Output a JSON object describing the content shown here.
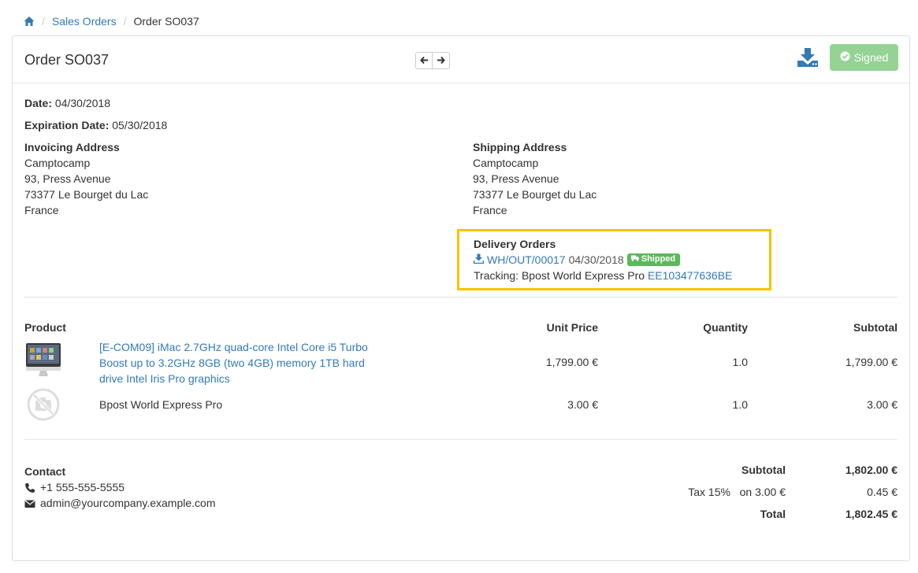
{
  "breadcrumb": {
    "home_icon": "home-icon",
    "sales_orders": "Sales Orders",
    "current": "Order SO037"
  },
  "header": {
    "title": "Order SO037",
    "prev_icon": "arrow-left-icon",
    "next_icon": "arrow-right-icon",
    "download_icon": "download-icon",
    "signed_label": "Signed",
    "signed_icon": "check-circle-icon"
  },
  "dates": {
    "date_label": "Date:",
    "date_value": "04/30/2018",
    "expiration_label": "Expiration Date:",
    "expiration_value": "05/30/2018"
  },
  "invoicing": {
    "title": "Invoicing Address",
    "lines": [
      "Camptocamp",
      "93, Press Avenue",
      "73377 Le Bourget du Lac",
      "France"
    ]
  },
  "shipping": {
    "title": "Shipping Address",
    "lines": [
      "Camptocamp",
      "93, Press Avenue",
      "73377 Le Bourget du Lac",
      "France"
    ]
  },
  "delivery": {
    "title": "Delivery Orders",
    "reference": "WH/OUT/00017",
    "date": "04/30/2018",
    "badge": "Shipped",
    "badge_icon": "truck-icon",
    "tracking_label": "Tracking: Bpost World Express Pro",
    "tracking_number": "EE103477636BE"
  },
  "table": {
    "headers": {
      "product": "Product",
      "unit_price": "Unit Price",
      "quantity": "Quantity",
      "subtotal": "Subtotal"
    },
    "rows": [
      {
        "name": "[E-COM09] iMac 2.7GHz quad-core Intel Core i5 Turbo Boost up to 3.2GHz 8GB (two 4GB) memory 1TB hard drive Intel Iris Pro graphics",
        "name_lines": [
          "[E-COM09] iMac 2.7GHz quad-core Intel Core i5 Turbo",
          "Boost up to 3.2GHz 8GB (two 4GB) memory 1TB hard",
          "drive Intel Iris Pro graphics"
        ],
        "unit_price": "1,799.00 €",
        "quantity": "1.0",
        "subtotal": "1,799.00 €"
      },
      {
        "name": "Bpost World Express Pro",
        "unit_price": "3.00 €",
        "quantity": "1.0",
        "subtotal": "3.00 €"
      }
    ]
  },
  "contact": {
    "title": "Contact",
    "phone": "+1 555-555-5555",
    "email": "admin@yourcompany.example.com",
    "phone_icon": "phone-icon",
    "email_icon": "envelope-icon"
  },
  "totals": {
    "subtotal_label": "Subtotal",
    "subtotal_value": "1,802.00 €",
    "tax_label": "Tax 15%",
    "tax_base": "on 3.00 €",
    "tax_value": "0.45 €",
    "total_label": "Total",
    "total_value": "1,802.45 €"
  },
  "colors": {
    "link": "#337ab7",
    "signed_bg": "#8fd18f",
    "badge_bg": "#5cb85c",
    "highlight_border": "#f5c400"
  }
}
